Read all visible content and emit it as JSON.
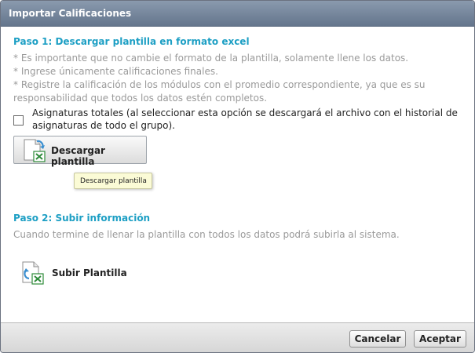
{
  "dialog": {
    "title": "Importar Calificaciones"
  },
  "step1": {
    "title": "Paso 1: Descargar plantilla en formato excel",
    "notes": [
      "* Es importante que no cambie el formato de la plantilla, solamente llene los datos.",
      "* Ingrese únicamente calificaciones finales.",
      "* Registre la calificación de los módulos con el promedio correspondiente, ya que es su responsabilidad que todos los datos estén completos."
    ],
    "checkbox_label": "Asignaturas totales (al seleccionar esta opción se descargará el archivo con el historial de asignaturas de todo el grupo).",
    "checkbox_checked": false,
    "download_button": "Descargar plantilla",
    "tooltip": "Descargar plantilla"
  },
  "step2": {
    "title": "Paso 2: Subir información",
    "note": "Cuando termine de llenar la plantilla con todos los datos podrá subirla al sistema.",
    "upload_button": "Subir Plantilla"
  },
  "footer": {
    "cancel": "Cancelar",
    "accept": "Aceptar"
  },
  "colors": {
    "accent": "#1d9fc4",
    "titlebar": "#7485a0",
    "note_text": "#9a9a9a",
    "excel_green": "#2e8b3a"
  },
  "icons": {
    "download": "excel-download-icon",
    "upload": "excel-upload-icon"
  }
}
